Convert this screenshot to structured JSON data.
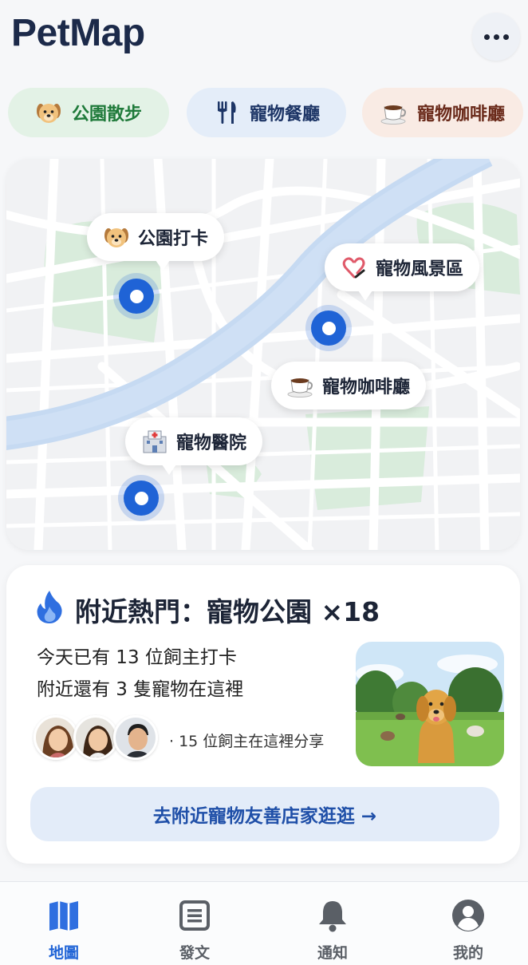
{
  "app": {
    "title": "PetMap"
  },
  "header": {
    "more_icon": "more-horizontal-icon"
  },
  "categories": [
    {
      "label": "公園散步",
      "icon": "dog-face-icon",
      "color": "#1f7a3a"
    },
    {
      "label": "寵物餐廳",
      "icon": "fork-knife-icon",
      "color": "#1d3566"
    },
    {
      "label": "寵物咖啡廳",
      "icon": "coffee-cup-icon",
      "color": "#6a2a1a"
    }
  ],
  "map": {
    "places": [
      {
        "label": "公園打卡",
        "icon": "dog-face-icon"
      },
      {
        "label": "寵物風景區",
        "icon": "paw-heart-icon"
      },
      {
        "label": "寵物咖啡廳",
        "icon": "coffee-cup-icon"
      },
      {
        "label": "寵物醫院",
        "icon": "hospital-icon"
      }
    ],
    "pin_color": "#1f63d6"
  },
  "trending": {
    "title": "附近熱門：寵物公園 ×18",
    "line1": "今天已有 13 位飼主打卡",
    "line2": "附近還有 3 隻寵物在這裡",
    "share_text": "· 15 位飼主在這裡分享",
    "cta_label": "去附近寵物友善店家逛逛 →"
  },
  "bottom_nav": [
    {
      "label": "地圖",
      "icon": "map-icon",
      "active": true
    },
    {
      "label": "發文",
      "icon": "post-icon",
      "active": false
    },
    {
      "label": "通知",
      "icon": "bell-icon",
      "active": false
    },
    {
      "label": "我的",
      "icon": "user-icon",
      "active": false
    }
  ],
  "colors": {
    "accent": "#1f63d6",
    "background": "#f6f7f9"
  }
}
